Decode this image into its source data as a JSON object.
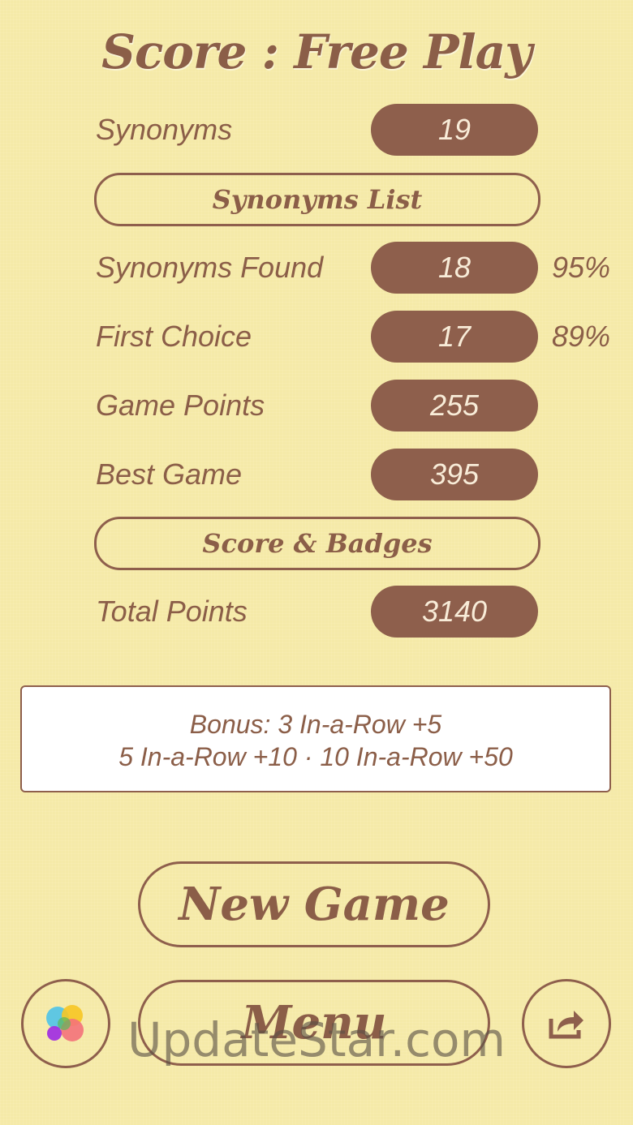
{
  "title": "Score : Free Play",
  "rows": [
    {
      "label": "Synonyms",
      "value": "19",
      "pct": ""
    },
    {
      "label": "Synonyms Found",
      "value": "18",
      "pct": "95%"
    },
    {
      "label": "First Choice",
      "value": "17",
      "pct": "89%"
    },
    {
      "label": "Game Points",
      "value": "255",
      "pct": ""
    },
    {
      "label": "Best Game",
      "value": "395",
      "pct": ""
    },
    {
      "label": "Total Points",
      "value": "3140",
      "pct": ""
    }
  ],
  "buttons": {
    "synonyms_list": "Synonyms List",
    "score_badges": "Score & Badges",
    "new_game": "New Game",
    "menu": "Menu"
  },
  "bonus": {
    "line1": "Bonus: 3 In-a-Row +5",
    "line2": "5 In-a-Row +10 · 10 In-a-Row +50"
  },
  "watermark": "UpdateStar.com",
  "icons": {
    "left": "game-center-icon",
    "right": "share-icon"
  },
  "colors": {
    "background": "#f5eaa8",
    "brown": "#8e5f4c",
    "pill_text": "#f8ecd8"
  }
}
